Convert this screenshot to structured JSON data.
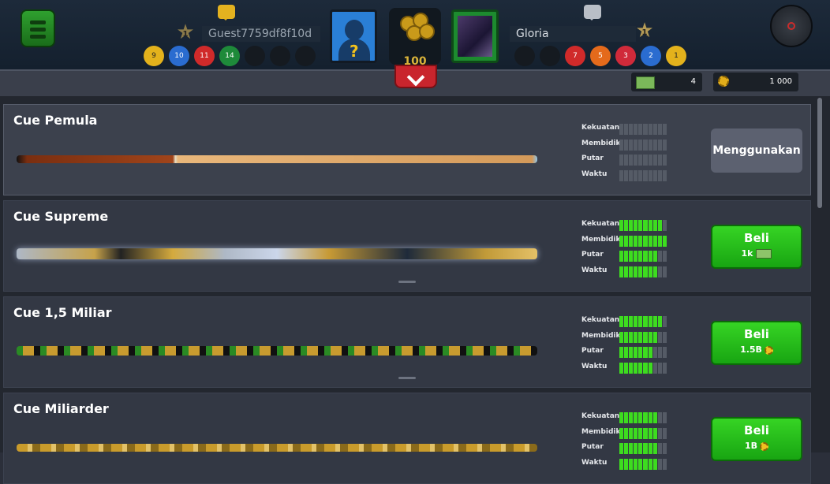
{
  "player_left": {
    "name": "Guest7759df8f10d",
    "level": "1",
    "balls": [
      "9",
      "10",
      "11",
      "14",
      "",
      "",
      ""
    ]
  },
  "player_right": {
    "name": "Gloria",
    "level": "1",
    "balls": [
      "",
      "",
      "7",
      "5",
      "3",
      "2",
      "1"
    ]
  },
  "pot": {
    "amount": "100"
  },
  "currency": {
    "cash": "4",
    "coins": "1 000"
  },
  "colors": {
    "accent_green": "#3ddc1f",
    "buy_button": "#1fb818",
    "collapse_red": "#c9252d"
  },
  "stat_labels": [
    "Kekuatan",
    "Membidik",
    "Putar",
    "Waktu"
  ],
  "cues": [
    {
      "name": "Cue Pemula",
      "action": "Menggunakan",
      "price": "",
      "stats": [
        0,
        0,
        0,
        0
      ]
    },
    {
      "name": "Cue Supreme",
      "action": "Beli",
      "price": "1k",
      "price_icon": "cash-icon",
      "stats": [
        9,
        10,
        8,
        8
      ]
    },
    {
      "name": "Cue 1,5 Miliar",
      "action": "Beli",
      "price": "1.5B",
      "price_icon": "coin-icon",
      "stats": [
        9,
        8,
        7,
        7
      ]
    },
    {
      "name": "Cue Miliarder",
      "action": "Beli",
      "price": "1B",
      "price_icon": "coin-icon",
      "stats": [
        8,
        8,
        8,
        8
      ]
    }
  ]
}
